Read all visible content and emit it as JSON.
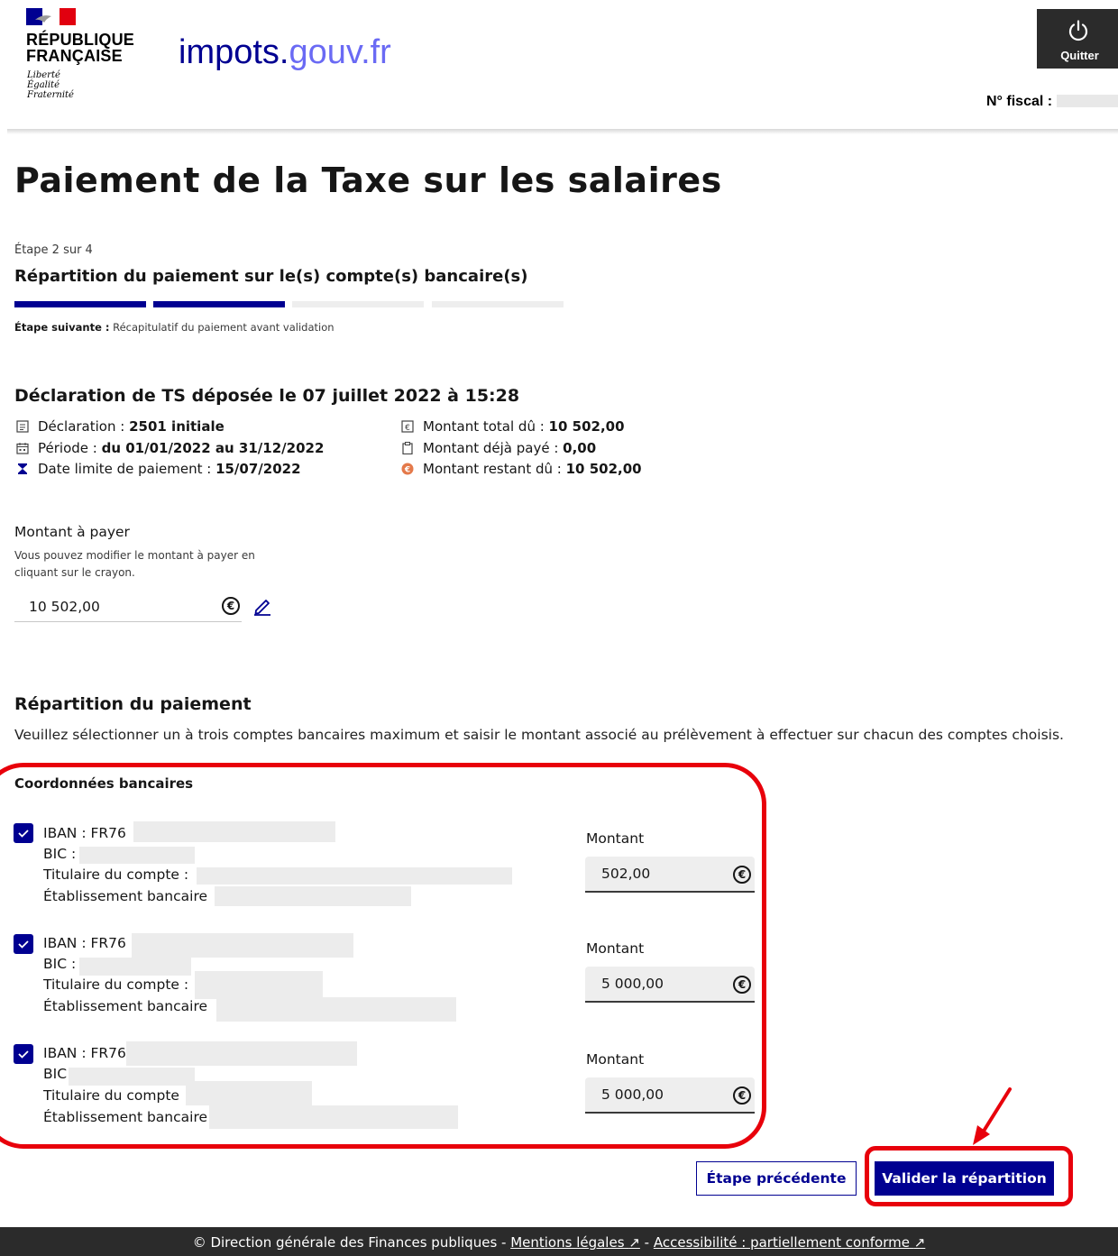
{
  "header": {
    "republic_line1": "RÉPUBLIQUE",
    "republic_line2": "FRANÇAISE",
    "motto": [
      "Liberté",
      "Égalité",
      "Fraternité"
    ],
    "site_name_main": "impots.",
    "site_name_suffix": "gouv.fr",
    "quit_label": "Quitter",
    "fiscal_label": "N° fiscal : "
  },
  "page": {
    "title": "Paiement de la Taxe sur les salaires",
    "step_count": "Étape 2 sur 4",
    "step_title": "Répartition du paiement sur le(s) compte(s) bancaire(s)",
    "next_step_label": "Étape suivante :",
    "next_step_value": " Récapitulatif du paiement avant validation"
  },
  "declaration": {
    "title": "Déclaration de TS déposée le 07 juillet 2022 à 15:28",
    "left": [
      {
        "label": "Déclaration : ",
        "value": "2501 initiale",
        "icon": "document-icon"
      },
      {
        "label": "Période : ",
        "value": "du 01/01/2022 au 31/12/2022",
        "icon": "calendar-icon"
      },
      {
        "label": "Date limite de paiement : ",
        "value": "15/07/2022",
        "icon": "hourglass-icon"
      }
    ],
    "right": [
      {
        "label": "Montant total dû : ",
        "value": "10 502,00",
        "icon": "euro-note-icon"
      },
      {
        "label": "Montant déjà payé : ",
        "value": "0,00",
        "icon": "clipboard-icon"
      },
      {
        "label": "Montant restant dû : ",
        "value": "10 502,00",
        "icon": "euro-coin-icon"
      }
    ]
  },
  "amount": {
    "label": "Montant à payer",
    "hint": "Vous pouvez modifier le montant à payer en cliquant sur le crayon.",
    "value": "10 502,00",
    "currency": "€"
  },
  "repartition": {
    "title": "Répartition du paiement",
    "description": "Veuillez sélectionner un à trois comptes bancaires maximum et saisir le montant associé au prélèvement à effectuer sur chacun des comptes choisis.",
    "coord_title": "Coordonnées bancaires",
    "amount_label": "Montant",
    "accounts": [
      {
        "checked": true,
        "iban": "IBAN : FR76 ",
        "bic": "BIC :",
        "holder": "Titulaire du compte :",
        "bank": "Établissement bancaire",
        "amount": "502,00"
      },
      {
        "checked": true,
        "iban": "IBAN : FR76 ",
        "bic": "BIC :",
        "holder": "Titulaire du compte :",
        "bank": "Établissement bancaire",
        "amount": "5 000,00"
      },
      {
        "checked": true,
        "iban": "IBAN : FR76",
        "bic": "BIC",
        "holder": "Titulaire du compte",
        "bank": "Établissement bancaire",
        "amount": "5 000,00"
      }
    ]
  },
  "buttons": {
    "previous": "Étape précédente",
    "validate": "Valider la répartition"
  },
  "footer": {
    "copyright": "© Direction générale des Finances publiques - ",
    "legal": "Mentions légales",
    "separator": " - ",
    "accessibility": "Accessibilité : partiellement conforme",
    "external_glyph": "↗"
  },
  "colors": {
    "primary_blue": "#000091",
    "annotation_red": "#e8000b",
    "dark": "#2b2b2b"
  }
}
